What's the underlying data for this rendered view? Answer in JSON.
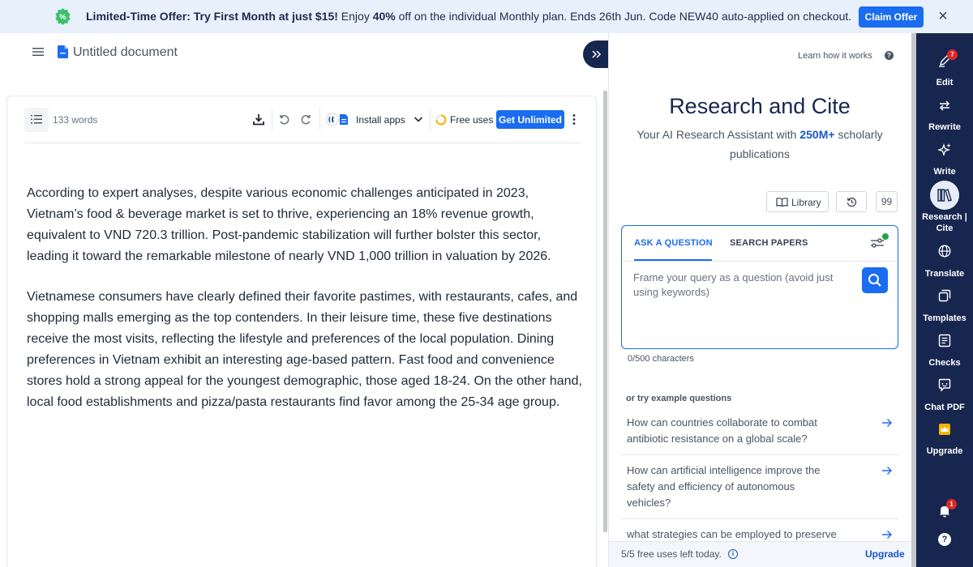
{
  "banner": {
    "lead": "Limited-Time Offer: Try First Month at just $15!",
    "mid1": " Enjoy ",
    "percent": "40%",
    "rest": " off on the individual Monthly plan. Ends 26th Jun. Code NEW40 auto-applied on checkout.",
    "badge_symbol": "%",
    "claim_label": "Claim Offer",
    "close_symbol": "×"
  },
  "document": {
    "title": "Untitled document",
    "word_count": "133 words",
    "paragraphs": [
      "According to expert analyses, despite various economic challenges anticipated in 2023, Vietnam’s food & beverage market is set to thrive, experiencing an 18% revenue growth, equivalent to VND 720.3 trillion. Post-pandemic stabilization will further bolster this sector, leading it toward the remarkable milestone of nearly VND 1,000 trillion in valuation by 2026.",
      "Vietnamese consumers have clearly defined their favorite pastimes, with restaurants, cafes, and shopping malls emerging as the top contenders. In their leisure time, these five destinations receive the most visits, reflecting the lifestyle and preferences of the local population. Dining preferences in Vietnam exhibit an interesting age-based pattern. Fast food and convenience stores hold a strong appeal for the youngest demographic, those aged 18-24. On the other hand, local food establishments and pizza/pasta restaurants find favor among the 25-34 age group."
    ]
  },
  "toolbar": {
    "install_label": "Install apps",
    "free_uses_label": "Free uses",
    "get_unlimited_label": "Get Unlimited"
  },
  "research": {
    "learn_label": "Learn how it works",
    "learn_help_symbol": "?",
    "title": "Research and Cite",
    "subtitle_pre": "Your AI Research Assistant with ",
    "subtitle_highlight": "250M+",
    "subtitle_post": " scholarly publications",
    "library_label": "Library",
    "count_label": "99",
    "tabs": [
      "ASK A QUESTION",
      "SEARCH PAPERS"
    ],
    "query_placeholder": "Frame your query as a question (avoid just using keywords)",
    "char_count": "0/500 characters",
    "try_label": "or try example questions",
    "examples": [
      "How can countries collaborate to combat antibiotic resistance on a global scale?",
      "How can artificial intelligence improve the safety and efficiency of autonomous vehicles?",
      "what strategies can be employed to preserve"
    ],
    "free_left": "5/5 free uses left today.",
    "info_symbol": "i",
    "upgrade_label": "Upgrade"
  },
  "sidebar": {
    "items": [
      {
        "label": "Edit",
        "icon": "pen-icon",
        "badge": "7"
      },
      {
        "label": "Rewrite",
        "icon": "rewrite-icon"
      },
      {
        "label": "Write",
        "icon": "sparkle-icon"
      },
      {
        "label": "Research | Cite",
        "icon": "books-icon"
      },
      {
        "label": "Translate",
        "icon": "globe-icon"
      },
      {
        "label": "Templates",
        "icon": "templates-icon"
      },
      {
        "label": "Checks",
        "icon": "checks-icon"
      },
      {
        "label": "Chat PDF",
        "icon": "chat-icon"
      },
      {
        "label": "Upgrade",
        "icon": "crown-icon"
      }
    ],
    "notification_badge": "1",
    "help_symbol": "?"
  },
  "colors": {
    "accent": "#1a6cf0",
    "sidebar_bg": "#16264f",
    "banner_bg": "#e8f0fc"
  }
}
